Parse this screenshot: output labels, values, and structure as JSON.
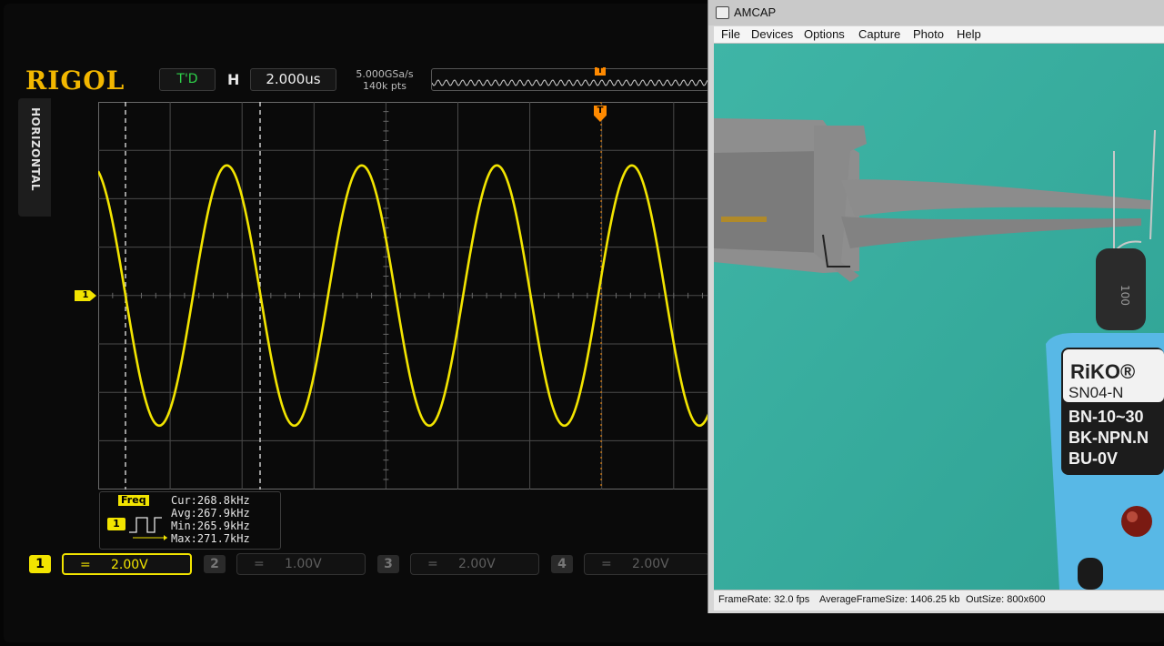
{
  "scope": {
    "brand": "RIGOL",
    "trigger_status": "T'D",
    "timebase_label": "H",
    "timebase": "2.000us",
    "sample_rate": "5.000GSa/s",
    "memory_depth": "140k pts",
    "side_tab": "HORIZONTAL",
    "ch1_marker": "1",
    "trigger_marker": "T",
    "measurement": {
      "title": "Freq",
      "channel": "1",
      "cur": "Cur:268.8kHz",
      "avg": "Avg:267.9kHz",
      "min": "Min:265.9kHz",
      "max": "Max:271.7kHz"
    },
    "channels": [
      {
        "num": "1",
        "coupling": "=",
        "scale": "2.00V",
        "active": true
      },
      {
        "num": "2",
        "coupling": "=",
        "scale": "1.00V",
        "active": false
      },
      {
        "num": "3",
        "coupling": "=",
        "scale": "2.00V",
        "active": false
      },
      {
        "num": "4",
        "coupling": "=",
        "scale": "2.00V",
        "active": false
      }
    ],
    "colors": {
      "ch1": "#f2e400",
      "brand": "#f2b700",
      "trigger": "#ff8a00",
      "status": "#2ed24a"
    }
  },
  "amcap": {
    "title": "AMCAP",
    "menu": [
      "File",
      "Devices",
      "Options",
      "Capture",
      "Photo",
      "Help"
    ],
    "status": {
      "frame_rate": "FrameRate: 32.0 fps",
      "avg_frame_size": "AverageFrameSize: 1406.25 kb",
      "out_size": "OutSize: 800x600"
    },
    "sensor_label": {
      "brand": "RiKO®",
      "model": "SN04-N",
      "line1": "BN-10~30",
      "line2": "BK-NPN.N",
      "line3": "BU-0V"
    },
    "inductor_marking": "100"
  }
}
